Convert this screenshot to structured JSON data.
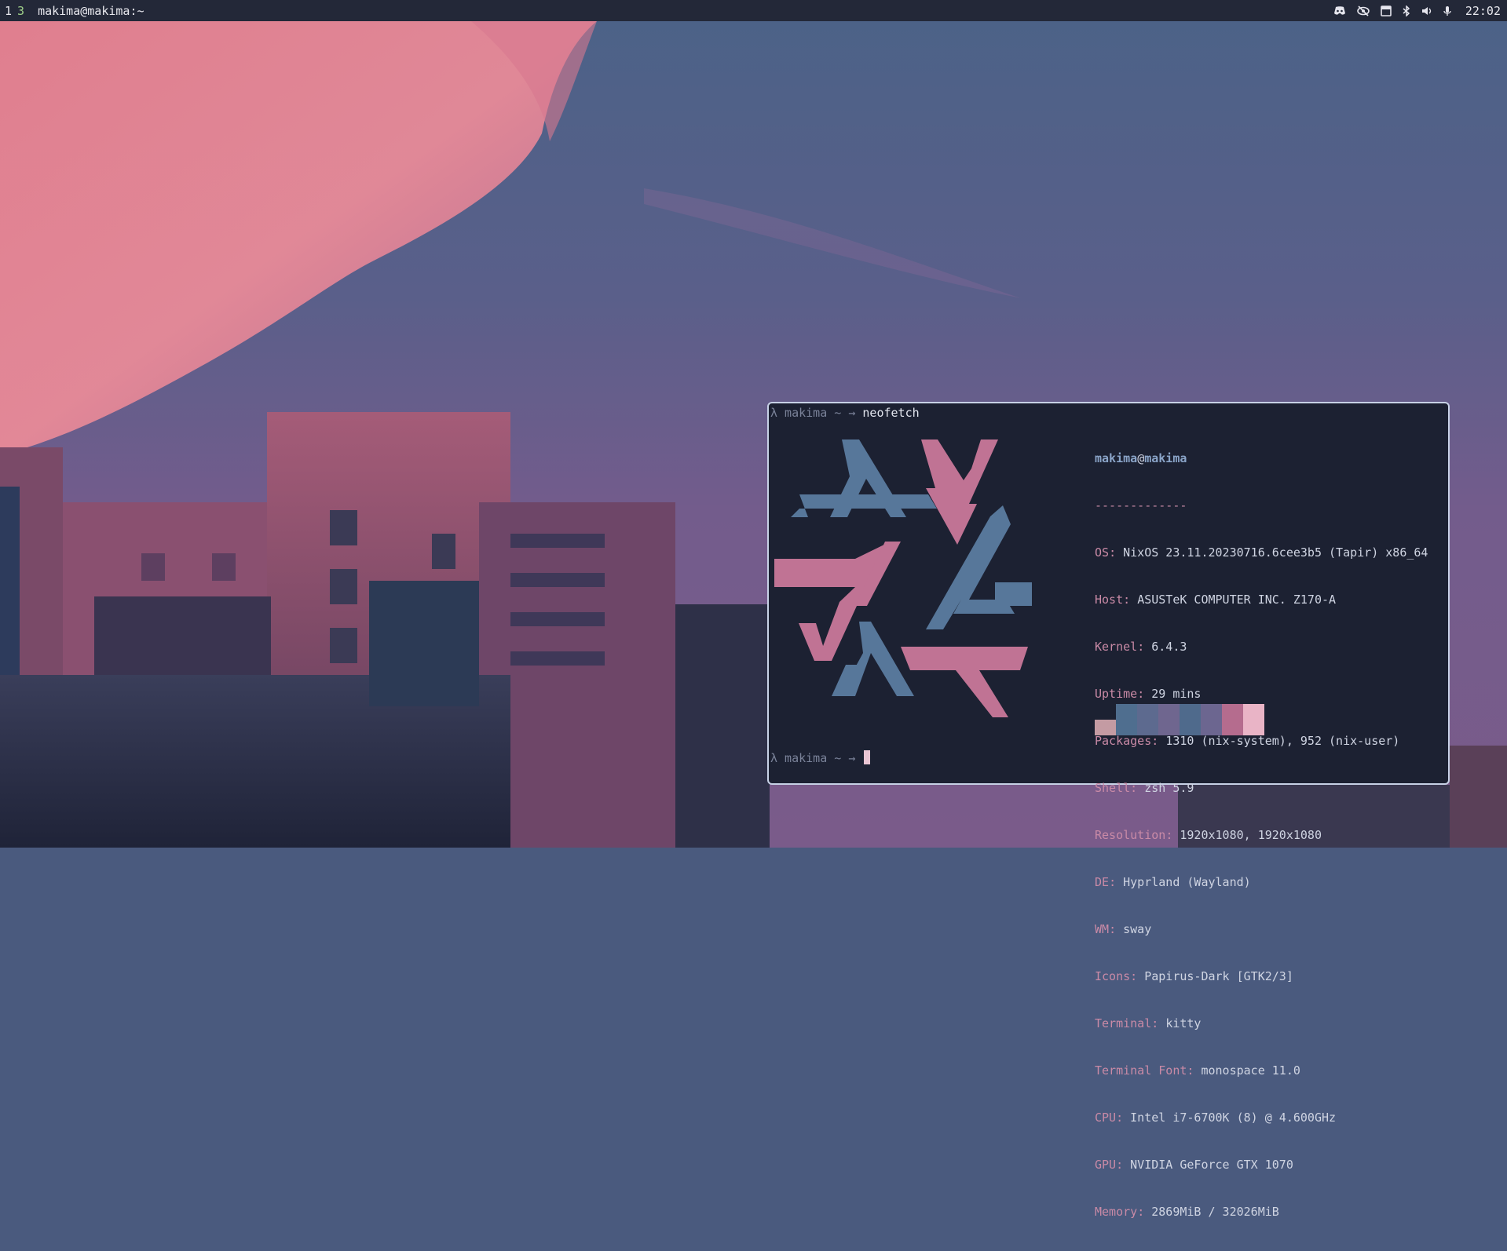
{
  "topbar": {
    "workspaces": [
      {
        "label": "1",
        "active": false
      },
      {
        "label": "3",
        "active": true
      }
    ],
    "window_title": "makima@makima:~",
    "tray_icons": [
      "discord-icon",
      "eye-slash-icon",
      "window-icon",
      "bluetooth-icon",
      "volume-icon",
      "microphone-icon"
    ],
    "clock": "22:02"
  },
  "terminal": {
    "prompt_user": "λ makima ~ →",
    "command": "neofetch",
    "neofetch": {
      "user": "makima",
      "at": "@",
      "host": "makima",
      "separator": "-------------",
      "fields": [
        {
          "key": "OS",
          "value": "NixOS 23.11.20230716.6cee3b5 (Tapir) x86_64"
        },
        {
          "key": "Host",
          "value": "ASUSTeK COMPUTER INC. Z170-A"
        },
        {
          "key": "Kernel",
          "value": "6.4.3"
        },
        {
          "key": "Uptime",
          "value": "29 mins"
        },
        {
          "key": "Packages",
          "value": "1310 (nix-system), 952 (nix-user)"
        },
        {
          "key": "Shell",
          "value": "zsh 5.9"
        },
        {
          "key": "Resolution",
          "value": "1920x1080, 1920x1080"
        },
        {
          "key": "DE",
          "value": "Hyprland (Wayland)"
        },
        {
          "key": "WM",
          "value": "sway"
        },
        {
          "key": "Icons",
          "value": "Papirus-Dark [GTK2/3]"
        },
        {
          "key": "Terminal",
          "value": "kitty"
        },
        {
          "key": "Terminal Font",
          "value": "monospace 11.0"
        },
        {
          "key": "CPU",
          "value": "Intel i7-6700K (8) @ 4.600GHz"
        },
        {
          "key": "GPU",
          "value": "NVIDIA GeForce GTX 1070"
        },
        {
          "key": "Memory",
          "value": "2869MiB / 32026MiB"
        }
      ],
      "palette": [
        "#c49ba3",
        "#4f6e8f",
        "#5d6a8f",
        "#6f668f",
        "#4f6a8c",
        "#6c6690",
        "#b56c8e",
        "#e9b4c6"
      ],
      "logo_colors": {
        "blue": "#57779a",
        "pink": "#c07394"
      }
    },
    "second_prompt": "λ makima ~ →"
  },
  "colors": {
    "bar_bg": "#232838",
    "terminal_bg": "#1c2132",
    "key_color": "#c98aa6",
    "active_workspace": "#9fd08a"
  }
}
